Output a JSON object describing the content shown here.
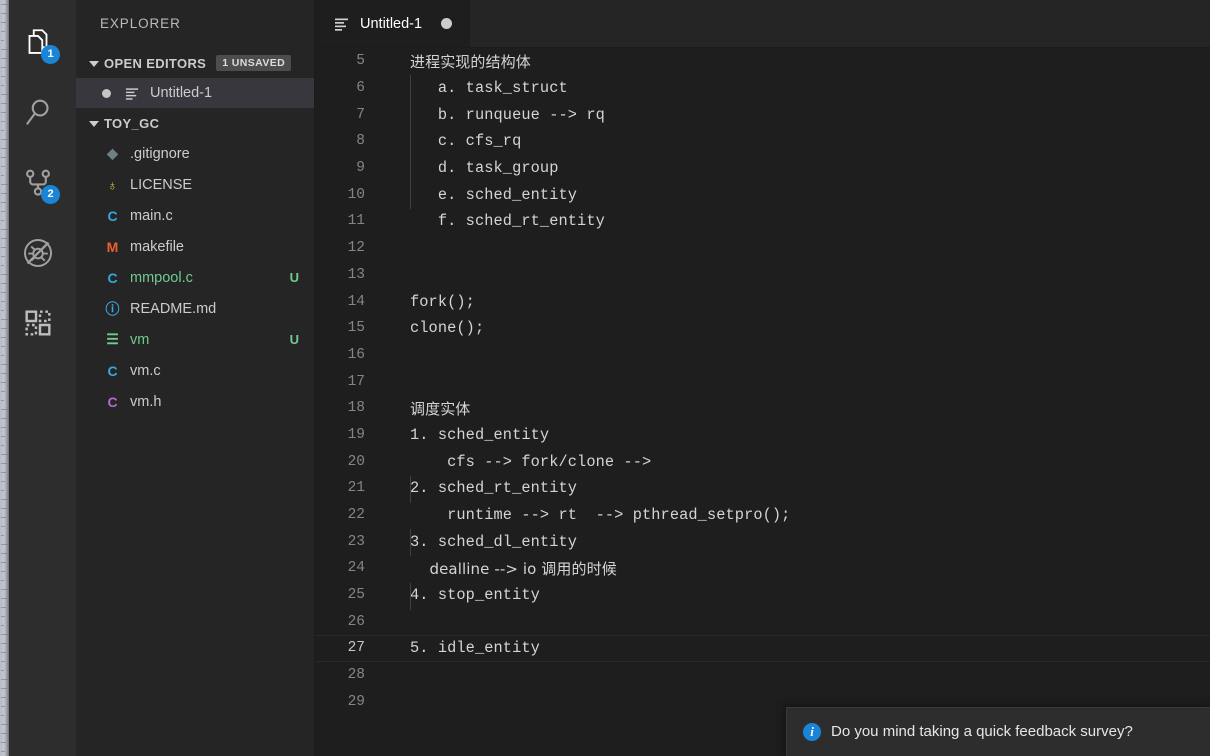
{
  "colors": {
    "accent": "#1a85d6",
    "editor_bg": "#1e1e1e",
    "sidebar_bg": "#252526",
    "activitybar_bg": "#2d2d2d",
    "modified_green": "#73c991",
    "text": "#cccccc"
  },
  "activity_bar": {
    "items": [
      {
        "name": "explorer",
        "icon": "files-icon",
        "badge": "1",
        "active": true
      },
      {
        "name": "search",
        "icon": "search-icon",
        "badge": "",
        "active": false
      },
      {
        "name": "source-control",
        "icon": "source-control-icon",
        "badge": "2",
        "active": false
      },
      {
        "name": "run-and-debug",
        "icon": "run-debug-icon",
        "badge": "",
        "active": false
      },
      {
        "name": "extensions",
        "icon": "extensions-icon",
        "badge": "",
        "active": false
      }
    ]
  },
  "sidebar": {
    "title": "EXPLORER",
    "open_editors": {
      "label": "OPEN EDITORS",
      "badge": "1 UNSAVED",
      "items": [
        {
          "label": "Untitled-1",
          "dirty": true,
          "icon": "text-file-icon"
        }
      ]
    },
    "folder": {
      "label": "TOY_GC",
      "files": [
        {
          "name": ".gitignore",
          "icon": "git-icon",
          "icon_glyph": "◆",
          "icon_color": "#6d8086",
          "status": "",
          "modified": false
        },
        {
          "name": "LICENSE",
          "icon": "license-icon",
          "icon_glyph": "♁",
          "icon_color": "#d9c541",
          "status": "",
          "modified": false
        },
        {
          "name": "main.c",
          "icon": "c-file-icon",
          "icon_glyph": "C",
          "icon_color": "#3aa6dd",
          "status": "",
          "modified": false
        },
        {
          "name": "makefile",
          "icon": "makefile-icon",
          "icon_glyph": "M",
          "icon_color": "#e8622c",
          "status": "",
          "modified": false
        },
        {
          "name": "mmpool.c",
          "icon": "c-file-icon",
          "icon_glyph": "C",
          "icon_color": "#3aa6dd",
          "status": "U",
          "modified": true
        },
        {
          "name": "README.md",
          "icon": "info-icon",
          "icon_glyph": "ⓘ",
          "icon_color": "#3aa6dd",
          "status": "",
          "modified": false
        },
        {
          "name": "vm",
          "icon": "text-file-icon",
          "icon_glyph": "☰",
          "icon_color": "#73c991",
          "status": "U",
          "modified": true
        },
        {
          "name": "vm.c",
          "icon": "c-file-icon",
          "icon_glyph": "C",
          "icon_color": "#3aa6dd",
          "status": "",
          "modified": false
        },
        {
          "name": "vm.h",
          "icon": "h-file-icon",
          "icon_glyph": "C",
          "icon_color": "#b368d4",
          "status": "",
          "modified": false
        }
      ]
    }
  },
  "editor": {
    "tabs": [
      {
        "label": "Untitled-1",
        "dirty": true,
        "active": true,
        "icon": "text-file-icon"
      }
    ],
    "first_visible_line": 5,
    "active_line": 27,
    "lines": [
      {
        "n": 5,
        "text": "进程实现的结构体",
        "cjk": true
      },
      {
        "n": 6,
        "text": "   a. task_struct",
        "cjk": false
      },
      {
        "n": 7,
        "text": "   b. runqueue --> rq",
        "cjk": false
      },
      {
        "n": 8,
        "text": "   c. cfs_rq",
        "cjk": false
      },
      {
        "n": 9,
        "text": "   d. task_group",
        "cjk": false
      },
      {
        "n": 10,
        "text": "   e. sched_entity",
        "cjk": false
      },
      {
        "n": 11,
        "text": "   f. sched_rt_entity",
        "cjk": false
      },
      {
        "n": 12,
        "text": "",
        "cjk": false
      },
      {
        "n": 13,
        "text": "",
        "cjk": false
      },
      {
        "n": 14,
        "text": "fork();",
        "cjk": false
      },
      {
        "n": 15,
        "text": "clone();",
        "cjk": false
      },
      {
        "n": 16,
        "text": "",
        "cjk": false
      },
      {
        "n": 17,
        "text": "",
        "cjk": false
      },
      {
        "n": 18,
        "text": "调度实体",
        "cjk": true
      },
      {
        "n": 19,
        "text": "1. sched_entity",
        "cjk": false
      },
      {
        "n": 20,
        "text": "    cfs --> fork/clone -->",
        "cjk": false
      },
      {
        "n": 21,
        "text": "2. sched_rt_entity",
        "cjk": false
      },
      {
        "n": 22,
        "text": "    runtime --> rt  --> pthread_setpro();",
        "cjk": false
      },
      {
        "n": 23,
        "text": "3. sched_dl_entity",
        "cjk": false
      },
      {
        "n": 24,
        "text": "    dealline --> io 调用的时候",
        "cjk": true
      },
      {
        "n": 25,
        "text": "4. stop_entity",
        "cjk": false
      },
      {
        "n": 26,
        "text": "",
        "cjk": false
      },
      {
        "n": 27,
        "text": "5. idle_entity",
        "cjk": false
      },
      {
        "n": 28,
        "text": "",
        "cjk": false
      },
      {
        "n": 29,
        "text": "",
        "cjk": false
      }
    ]
  },
  "notification": {
    "icon": "info-icon",
    "icon_glyph": "i",
    "message": "Do you mind taking a quick feedback survey?"
  }
}
